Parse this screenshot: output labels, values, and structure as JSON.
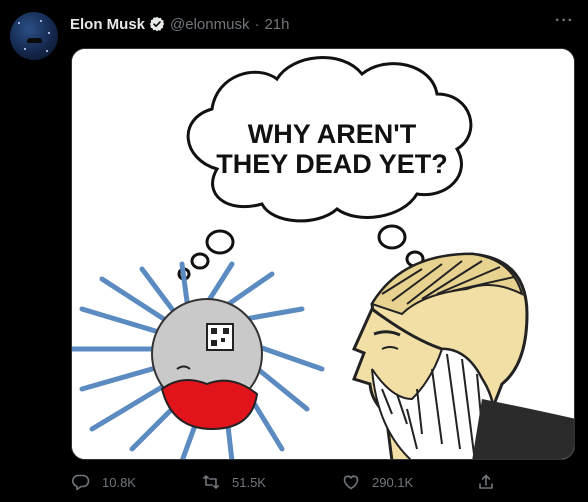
{
  "tweet": {
    "author_name": "Elon Musk",
    "handle": "@elonmusk",
    "separator": "·",
    "time": "21h",
    "more_icon": "more-horizontal-icon",
    "verified_icon": "verified-badge-icon",
    "image": {
      "thought_bubble_text_line1": "WHY AREN'T",
      "thought_bubble_text_line2": "THEY DEAD YET?"
    },
    "actions": {
      "reply_count": "10.8K",
      "retweet_count": "51.5K",
      "like_count": "290.1K"
    }
  },
  "colors": {
    "background": "#000000",
    "text_primary": "#e7e9ea",
    "text_secondary": "#71767b",
    "verified_blue": "#1d9bf0"
  }
}
